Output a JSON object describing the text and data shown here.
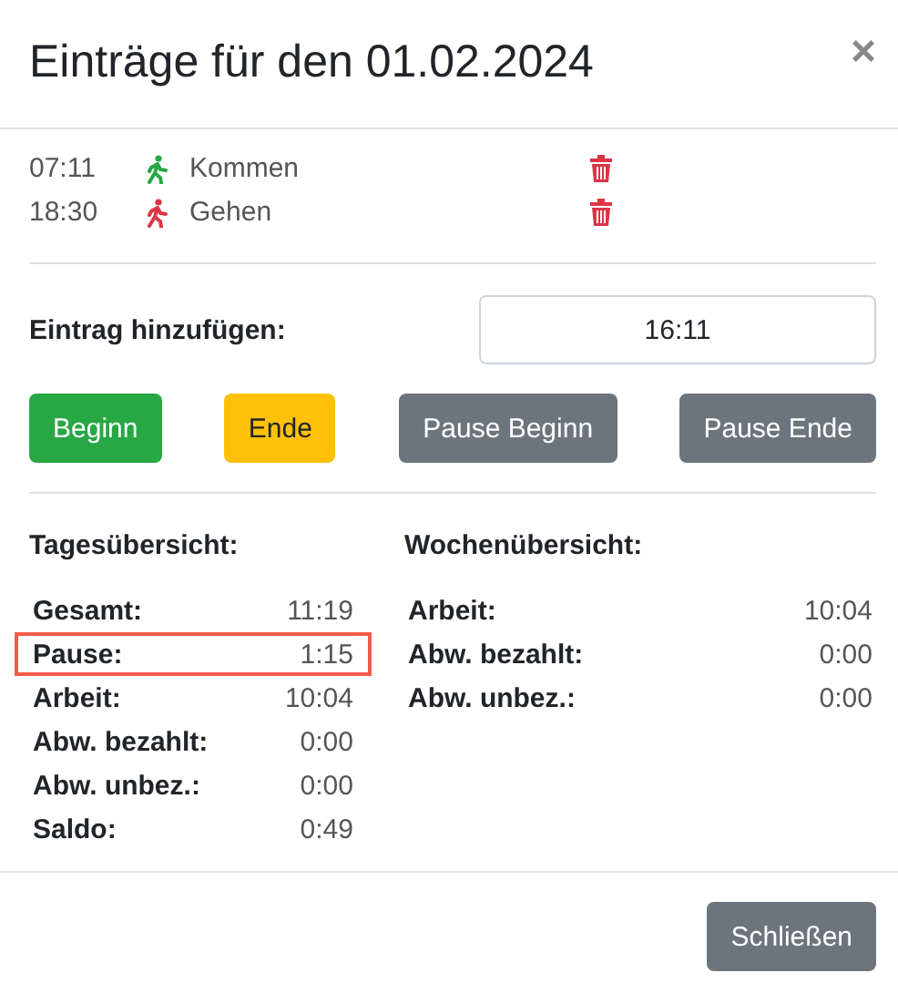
{
  "dialog": {
    "title": "Einträge für den 01.02.2024",
    "close": "×"
  },
  "entries": [
    {
      "time": "07:11",
      "kind": "in",
      "label": "Kommen"
    },
    {
      "time": "18:30",
      "kind": "out",
      "label": "Gehen"
    }
  ],
  "add_entry": {
    "label": "Eintrag hinzufügen:",
    "value": "16:11"
  },
  "actions": [
    {
      "label": "Beginn",
      "kind": "success"
    },
    {
      "label": "Ende",
      "kind": "warning"
    },
    {
      "label": "Pause Beginn",
      "kind": "secondary"
    },
    {
      "label": "Pause Ende",
      "kind": "secondary"
    }
  ],
  "day_summary": {
    "title": "Tagesübersicht:",
    "rows": [
      {
        "label": "Gesamt:",
        "value": "11:19",
        "highlighted": false
      },
      {
        "label": "Pause:",
        "value": "1:15",
        "highlighted": true
      },
      {
        "label": "Arbeit:",
        "value": "10:04",
        "highlighted": false
      },
      {
        "label": "Abw. bezahlt:",
        "value": "0:00",
        "highlighted": false
      },
      {
        "label": "Abw. unbez.:",
        "value": "0:00",
        "highlighted": false
      },
      {
        "label": "Saldo:",
        "value": "0:49",
        "highlighted": false
      }
    ]
  },
  "week_summary": {
    "title": "Wochenübersicht:",
    "rows": [
      {
        "label": "Arbeit:",
        "value": "10:04",
        "highlighted": false
      },
      {
        "label": "Abw. bezahlt:",
        "value": "0:00",
        "highlighted": false
      },
      {
        "label": "Abw. unbez.:",
        "value": "0:00",
        "highlighted": false
      }
    ]
  },
  "footer": {
    "close_button": "Schließen"
  }
}
